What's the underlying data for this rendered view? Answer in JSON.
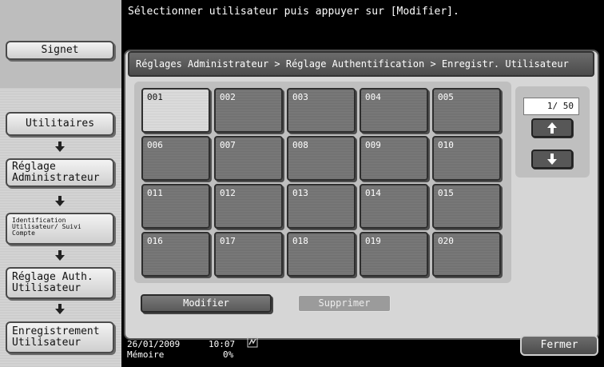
{
  "header": {
    "instruction": "Sélectionner utilisateur puis appuyer sur [Modifier]."
  },
  "sidebar": {
    "bookmark_label": "Signet",
    "utilities_label": "Utilitaires",
    "admin_settings_label": "Réglage Administrateur",
    "user_auth_tracking_label": "Identification Utilisateur/ Suivi Compte",
    "user_auth_settings_label": "Réglage Auth. Utilisateur",
    "user_registration_label": "Enregistrement Utilisateur"
  },
  "breadcrumb": "Réglages Administrateur > Réglage Authentification > Enregistr. Utilisateur",
  "users": [
    "001",
    "002",
    "003",
    "004",
    "005",
    "006",
    "007",
    "008",
    "009",
    "010",
    "011",
    "012",
    "013",
    "014",
    "015",
    "016",
    "017",
    "018",
    "019",
    "020"
  ],
  "selected_user": "001",
  "pager": {
    "indicator": "1/ 50"
  },
  "actions": {
    "modify_label": "Modifier",
    "delete_label": "Supprimer"
  },
  "status": {
    "date": "26/01/2009",
    "time": "10:07",
    "memory_label": "Mémoire",
    "memory_value": "0%"
  },
  "close_label": "Fermer"
}
